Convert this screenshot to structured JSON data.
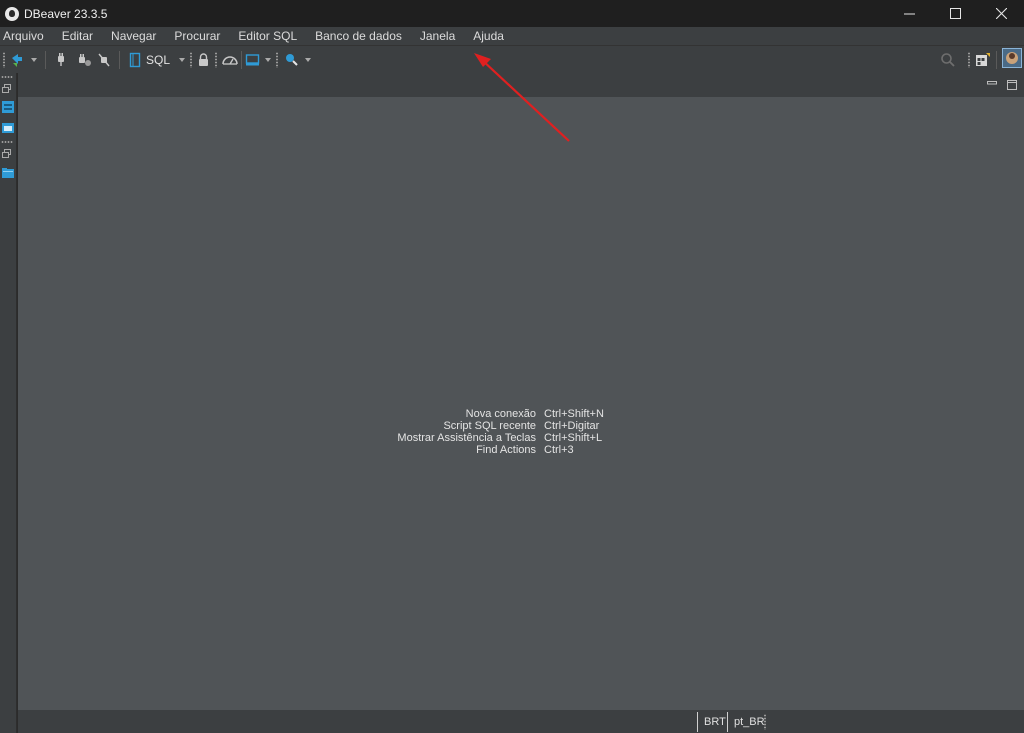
{
  "window": {
    "title": "DBeaver 23.3.5",
    "controls": [
      "minimize-icon",
      "maximize-icon",
      "close-icon"
    ]
  },
  "menu": {
    "items": [
      "Arquivo",
      "Editar",
      "Navegar",
      "Procurar",
      "Editor SQL",
      "Banco de dados",
      "Janela",
      "Ajuda"
    ]
  },
  "toolbar": {
    "sql_label": "SQL",
    "icons": [
      "new-connection-icon",
      "connect-icon",
      "disconnect-icon",
      "invalidate-icon",
      "sql-editor-icon",
      "transaction-lock-icon",
      "dashboard-icon",
      "commit-mode-icon",
      "search-tools-icon",
      "global-search-icon",
      "perspective-icon",
      "user-avatar-icon"
    ]
  },
  "left_strip": {
    "icons": [
      "restore-icon",
      "database-navigator-icon",
      "project-icon",
      "restore-icon",
      "folder-icon"
    ]
  },
  "editor": {
    "shortcuts": [
      {
        "name": "Nova conexão",
        "key": "Ctrl+Shift+N"
      },
      {
        "name": "Script SQL recente",
        "key": "Ctrl+Digitar"
      },
      {
        "name": "Mostrar Assistência a Teclas",
        "key": "Ctrl+Shift+L"
      },
      {
        "name": "Find Actions",
        "key": "Ctrl+3"
      }
    ]
  },
  "status": {
    "timezone": "BRT",
    "locale": "pt_BR"
  },
  "colors": {
    "accent": "#2f9bd6",
    "annotation_arrow": "#e02020",
    "editor_bg": "#505457"
  }
}
